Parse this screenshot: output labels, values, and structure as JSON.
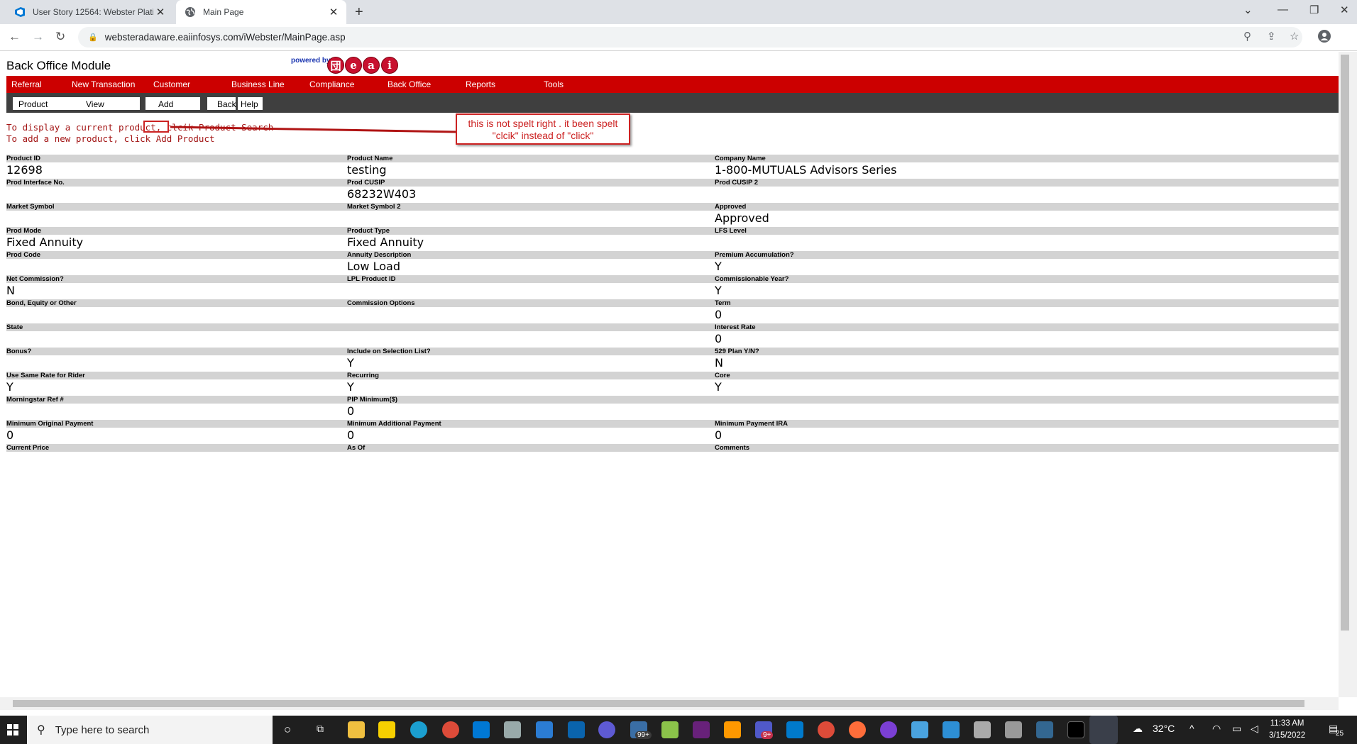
{
  "browser": {
    "tabs": [
      {
        "label": "User Story 12564: Webster Platin",
        "icon": "azure-devops-icon",
        "active": false
      },
      {
        "label": "Main Page",
        "icon": "globe-icon",
        "active": true
      }
    ],
    "url": "websteradaware.eaiinfosys.com/iWebster/MainPage.asp"
  },
  "app": {
    "title": "Back Office Module",
    "powered_by": "powered by",
    "logo_letters": [
      "団",
      "e",
      "a",
      "i"
    ]
  },
  "main_nav": [
    "Referral",
    "New Transaction",
    "Customer",
    "Business Line",
    "Compliance",
    "Back Office",
    "Reports",
    "Tools"
  ],
  "sub_nav": [
    "Product",
    "View",
    "Add",
    "Back",
    "Help"
  ],
  "instructions": {
    "line1": "To display a current product, clcik Product Search",
    "line2": "To add a new product, click Add Product"
  },
  "annotation": {
    "text_line1": "this is not spelt right . it been spelt",
    "text_line2": "\"clcik\" instead of \"click\"",
    "color": "#cc2222"
  },
  "product_fields": [
    [
      {
        "label": "Product ID",
        "value": "12698"
      },
      {
        "label": "Product Name",
        "value": "testing"
      },
      {
        "label": "Company Name",
        "value": "1-800-MUTUALS Advisors Series"
      }
    ],
    [
      {
        "label": "Prod Interface No.",
        "value": ""
      },
      {
        "label": "Prod CUSIP",
        "value": "68232W403"
      },
      {
        "label": "Prod CUSIP 2",
        "value": ""
      }
    ],
    [
      {
        "label": "Market Symbol",
        "value": ""
      },
      {
        "label": "Market Symbol 2",
        "value": ""
      },
      {
        "label": "Approved",
        "value": "Approved"
      }
    ],
    [
      {
        "label": "Prod Mode",
        "value": "Fixed Annuity"
      },
      {
        "label": "Product Type",
        "value": "Fixed Annuity"
      },
      {
        "label": "LFS Level",
        "value": ""
      }
    ],
    [
      {
        "label": "Prod Code",
        "value": ""
      },
      {
        "label": "Annuity Description",
        "value": "Low Load"
      },
      {
        "label": "Premium Accumulation?",
        "value": "Y"
      }
    ],
    [
      {
        "label": "Net Commission?",
        "value": "N"
      },
      {
        "label": "LPL Product ID",
        "value": ""
      },
      {
        "label": "Commissionable Year?",
        "value": "Y"
      }
    ],
    [
      {
        "label": "Bond, Equity or Other",
        "value": ""
      },
      {
        "label": "Commission Options",
        "value": ""
      },
      {
        "label": "Term",
        "value": "0"
      }
    ],
    [
      {
        "label": "State",
        "value": ""
      },
      {
        "label": "",
        "value": ""
      },
      {
        "label": "Interest Rate",
        "value": "0"
      }
    ],
    [
      {
        "label": "Bonus?",
        "value": ""
      },
      {
        "label": "Include on Selection List?",
        "value": "Y"
      },
      {
        "label": "529 Plan Y/N?",
        "value": "N"
      }
    ],
    [
      {
        "label": "Use Same Rate for Rider",
        "value": "Y"
      },
      {
        "label": "Recurring",
        "value": "Y"
      },
      {
        "label": "Core",
        "value": "Y"
      }
    ],
    [
      {
        "label": "Morningstar Ref #",
        "value": ""
      },
      {
        "label": "PIP Minimum($)",
        "value": "0"
      },
      {
        "label": "",
        "value": ""
      }
    ],
    [
      {
        "label": "Minimum Original Payment",
        "value": "0"
      },
      {
        "label": "Minimum Additional Payment",
        "value": "0"
      },
      {
        "label": "Minimum Payment IRA",
        "value": "0"
      }
    ],
    [
      {
        "label": "Current Price",
        "value": ""
      },
      {
        "label": "As Of",
        "value": ""
      },
      {
        "label": "Comments",
        "value": ""
      }
    ]
  ],
  "taskbar": {
    "search_placeholder": "Type here to search",
    "weather": "32°C",
    "time": "11:33 AM",
    "date": "3/15/2022",
    "badges": {
      "mail": "99+",
      "teams": "9+",
      "notifications": "25"
    }
  },
  "colors": {
    "nav_red": "#cc0000",
    "subnav_dark": "#3f3f3f",
    "instruction_text": "#a31515"
  }
}
